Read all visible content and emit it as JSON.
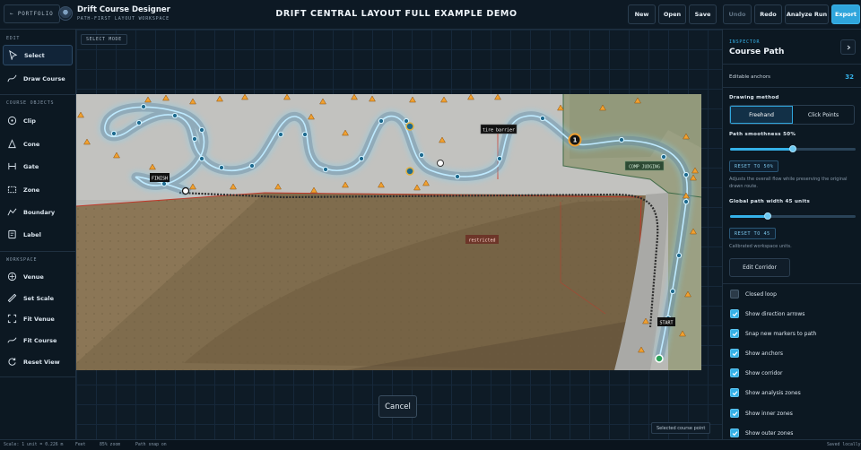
{
  "header": {
    "portfolio_label": "← PORTFOLIO",
    "app_title": "Drift Course Designer",
    "app_subtitle": "PATH-FIRST LAYOUT WORKSPACE",
    "document_title": "DRIFT CENTRAL LAYOUT FULL EXAMPLE DEMO",
    "buttons": {
      "new": "New",
      "open": "Open",
      "save": "Save",
      "undo": "Undo",
      "redo": "Redo",
      "analyze": "Analyze Run",
      "export": "Export"
    }
  },
  "sidebar": {
    "edit_heading": "EDIT",
    "edit_tools": [
      "Select",
      "Draw Course"
    ],
    "objects_heading": "COURSE OBJECTS",
    "object_tools": [
      "Clip",
      "Cone",
      "Gate",
      "Zone",
      "Boundary",
      "Label"
    ],
    "workspace_heading": "WORKSPACE",
    "workspace_tools": [
      "Venue",
      "Set Scale",
      "Fit Venue",
      "Fit Course",
      "Reset View"
    ]
  },
  "canvas": {
    "mode_badge": "SELECT MODE",
    "labels": {
      "tire_barrier": "tire barrier",
      "finish": "FINISH",
      "comp_judging": "COMP JUDGING",
      "restricted": "restricted",
      "start": "START",
      "clip_number": "1"
    },
    "cancel_label": "Cancel",
    "selected_badge": "Selected course point"
  },
  "inspector": {
    "kicker": "INSPECTOR",
    "title": "Course Path",
    "editable_anchors_label": "Editable anchors",
    "editable_anchors_value": "32",
    "drawing_method_label": "Drawing method",
    "methods": [
      "Freehand",
      "Click Points"
    ],
    "active_method": "Freehand",
    "smoothness_label": "Path smoothness 50%",
    "smoothness_value": 50,
    "smoothness_reset": "RESET TO 50%",
    "smoothness_note": "Adjusts the overall flow while preserving the original drawn route.",
    "width_label": "Global path width 45 units",
    "width_fraction": 0.3,
    "width_reset": "RESET TO 45",
    "width_note": "Calibrated workspace units.",
    "edit_corridor_label": "Edit Corridor",
    "options": [
      {
        "label": "Closed loop",
        "checked": false
      },
      {
        "label": "Show direction arrows",
        "checked": true
      },
      {
        "label": "Snap new markers to path",
        "checked": true
      },
      {
        "label": "Show anchors",
        "checked": true
      },
      {
        "label": "Show corridor",
        "checked": true
      },
      {
        "label": "Show analysis zones",
        "checked": true
      },
      {
        "label": "Show inner zones",
        "checked": true
      },
      {
        "label": "Show outer zones",
        "checked": true
      }
    ]
  },
  "status": {
    "scale": "Scale: 1 unit = 0.226 m",
    "units": "Feet",
    "zoom": "85% zoom",
    "snap": "Path snap on",
    "saved": "Saved locally"
  },
  "colors": {
    "accent": "#35b1e8",
    "cone": "#f0a030",
    "background": "#0b1520"
  }
}
